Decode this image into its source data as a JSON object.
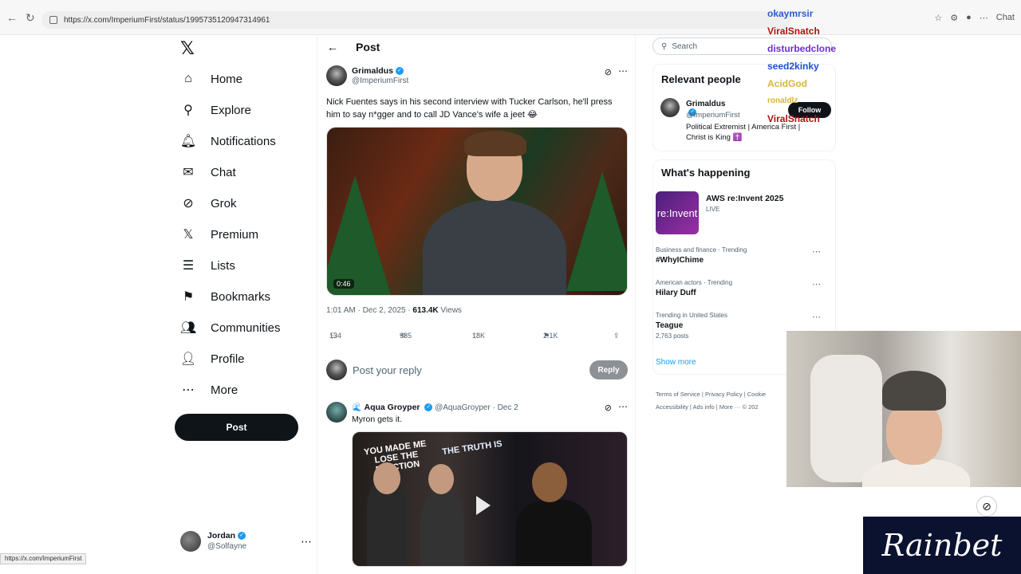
{
  "browser": {
    "url": "https://x.com/ImperiumFirst/status/1995735120947314961",
    "chat_label": "Chat"
  },
  "nav": {
    "items": [
      {
        "label": "Home",
        "icon": "home-icon"
      },
      {
        "label": "Explore",
        "icon": "search-icon"
      },
      {
        "label": "Notifications",
        "icon": "bell-icon",
        "badge": "1"
      },
      {
        "label": "Chat",
        "icon": "mail-icon"
      },
      {
        "label": "Grok",
        "icon": "grok-icon"
      },
      {
        "label": "Premium",
        "icon": "x-logo-icon"
      },
      {
        "label": "Lists",
        "icon": "list-icon"
      },
      {
        "label": "Bookmarks",
        "icon": "bookmark-icon"
      },
      {
        "label": "Communities",
        "icon": "people-icon"
      },
      {
        "label": "Profile",
        "icon": "person-icon"
      },
      {
        "label": "More",
        "icon": "more-circle-icon"
      }
    ],
    "post_button": "Post",
    "account": {
      "name": "Jordan",
      "handle": "@Solfayne"
    }
  },
  "main": {
    "header_title": "Post",
    "tweet": {
      "name": "Grimaldus",
      "handle": "@ImperiumFirst",
      "text": "Nick Fuentes says in his second interview with Tucker Carlson, he'll press him to say n*gger and to call JD Vance's wife a jeet 😂",
      "video_duration": "0:46",
      "time": "1:01 AM · Dec 2, 2025 · ",
      "views": "613.4K",
      "views_label": " Views",
      "replies": "134",
      "reposts": "985",
      "likes": "18K",
      "bookmarks": "2.1K"
    },
    "reply_placeholder": "Post your reply",
    "reply_button": "Reply",
    "reply": {
      "name": "Aqua Groyper",
      "handle": "@AquaGroyper · Dec 2",
      "text": "Myron gets it.",
      "sign1": "YOU MADE ME LOSE THE ELECTION",
      "sign2": "THE TRUTH IS"
    }
  },
  "sidebar": {
    "search_placeholder": "Search",
    "relevant_title": "Relevant people",
    "person": {
      "name": "Grimaldus",
      "handle": "@ImperiumFirst",
      "bio": "Political Extremist | America First | Christ is King ✝️",
      "follow": "Follow"
    },
    "happening_title": "What's happening",
    "event": {
      "title": "AWS re:Invent 2025",
      "status": "LIVE",
      "image_text": "re:Invent"
    },
    "trends": [
      {
        "context": "Business and finance · Trending",
        "title": "#WhyIChime",
        "sub": ""
      },
      {
        "context": "American actors · Trending",
        "title": "Hilary Duff",
        "sub": ""
      },
      {
        "context": "Trending in United States",
        "title": "Teague",
        "sub": "2,763 posts"
      }
    ],
    "show_more": "Show more",
    "footer_line1": "Terms of Service  |  Privacy Policy  |  Cookie",
    "footer_line2": "Accessibility  |  Ads info  |  More ···  © 202"
  },
  "stream": {
    "chat_names": [
      "okaymrsir",
      "ViralSnatch",
      "disturbedclone",
      "seed2kinky",
      "AcidGod",
      "ronaldlz",
      "ViralSnatch"
    ],
    "logo_text": "Rainbet"
  },
  "status_bar_url": "https://x.com/ImperiumFirst"
}
